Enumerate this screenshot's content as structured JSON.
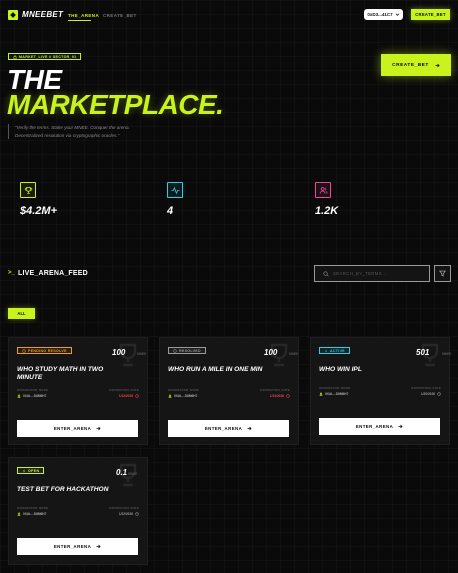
{
  "nav": {
    "logo": "MNEEBET",
    "links": [
      "THE_ARENA",
      "CREATE_BET"
    ],
    "wallet": "0xD3...41C7",
    "create_label": "CREATE_BET"
  },
  "hero": {
    "badge": "MARKET_LIVE // SECTOR_01",
    "title_line1": "THE",
    "title_line2": "MARKETPLACE.",
    "subtitle_line1": "\"Verify the terms. Stake your MNEE. Conquer the arena.",
    "subtitle_line2": "Decentralized resolution via cryptographic oracles.\"",
    "create_label": "CREATE_BET"
  },
  "stats": [
    {
      "icon": "trophy-icon",
      "value": "$4.2M+",
      "color": "#c8f31d"
    },
    {
      "icon": "activity-icon",
      "value": "4",
      "color": "#22d3ee"
    },
    {
      "icon": "users-icon",
      "value": "1.2K",
      "color": "#ec4899"
    }
  ],
  "feed": {
    "title": "LIVE_ARENA_FEED",
    "search_placeholder": "SEARCH_BY_TERMS...",
    "all_label": "ALL"
  },
  "cards": [
    {
      "status": "PENDING RESOLVE",
      "status_color": "#f59e0b",
      "amount": "100",
      "unit": "MNEE",
      "title": "WHO STUDY MATH IN TWO MINUTE",
      "originator_label": "ORIGINATOR_NODE",
      "originator": "0XAL...D8M6H7",
      "expiration_label": "EXPIRATION_DATE",
      "expiration": "1/13/2026",
      "exp_color": "#ef4444",
      "enter_label": "ENTER_ARENA"
    },
    {
      "status": "RESOLVED",
      "status_color": "#9a9a9a",
      "amount": "100",
      "unit": "MNEE",
      "title": "WHO RUN A MILE IN ONE MIN",
      "originator_label": "ORIGINATOR_NODE",
      "originator": "0XAL...D8M6H7",
      "expiration_label": "EXPIRATION_DATE",
      "expiration": "1/13/2026",
      "exp_color": "#ef4444",
      "enter_label": "ENTER_ARENA"
    },
    {
      "status": "ACTIVE",
      "status_color": "#22d3ee",
      "amount": "501",
      "unit": "MNEE",
      "title": "WHO WIN IPL",
      "originator_label": "ORIGINATOR_NODE",
      "originator": "0XAL...D8M6H7",
      "expiration_label": "EXPIRATION_DATE",
      "expiration": "1/20/2026",
      "exp_color": "#9a9a9a",
      "enter_label": "ENTER_ARENA"
    },
    {
      "status": "OPEN",
      "status_color": "#c8f31d",
      "amount": "0.1",
      "unit": "MNEE",
      "title": "TEST BET FOR HACKATHON",
      "originator_label": "ORIGINATOR_NODE",
      "originator": "0XAL...D8M6H7",
      "expiration_label": "EXPIRATION_DATE",
      "expiration": "1/22/2026",
      "exp_color": "#9a9a9a",
      "enter_label": "ENTER_ARENA"
    }
  ]
}
